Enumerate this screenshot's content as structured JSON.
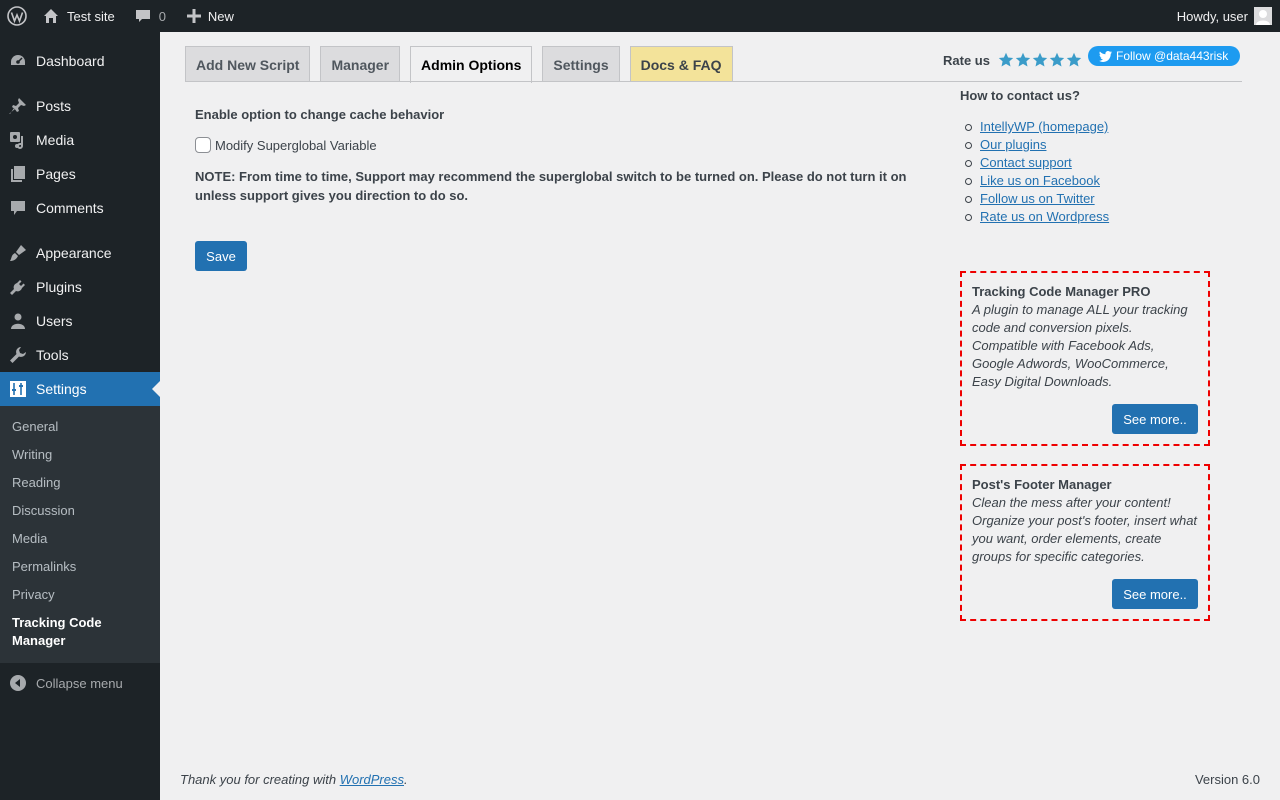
{
  "adminbar": {
    "site_name": "Test site",
    "comments_count": "0",
    "new_label": "New",
    "greeting": "Howdy, user"
  },
  "sidebar": {
    "items": [
      {
        "label": "Dashboard",
        "icon": "dashboard-icon"
      },
      {
        "label": "Posts",
        "icon": "pin-icon"
      },
      {
        "label": "Media",
        "icon": "media-icon"
      },
      {
        "label": "Pages",
        "icon": "pages-icon"
      },
      {
        "label": "Comments",
        "icon": "comment-icon"
      },
      {
        "label": "Appearance",
        "icon": "brush-icon"
      },
      {
        "label": "Plugins",
        "icon": "plug-icon"
      },
      {
        "label": "Users",
        "icon": "user-icon"
      },
      {
        "label": "Tools",
        "icon": "wrench-icon"
      },
      {
        "label": "Settings",
        "icon": "settings-icon"
      }
    ],
    "submenu": [
      "General",
      "Writing",
      "Reading",
      "Discussion",
      "Media",
      "Permalinks",
      "Privacy",
      "Tracking Code Manager"
    ],
    "collapse_label": "Collapse menu"
  },
  "tabs": [
    "Add New Script",
    "Manager",
    "Admin Options",
    "Settings",
    "Docs & FAQ"
  ],
  "rate": {
    "label": "Rate us",
    "stars": 5
  },
  "follow_label": "Follow @data443risk",
  "main": {
    "heading": "Enable option to change cache behavior",
    "checkbox_label": "Modify Superglobal Variable",
    "note": "NOTE: From time to time, Support may recommend the superglobal switch to be turned on. Please do not turn it on unless support gives you direction to do so.",
    "save_label": "Save"
  },
  "side": {
    "contact_title": "How to contact us?",
    "links": [
      "IntellyWP (homepage)",
      "Our plugins",
      "Contact support",
      "Like us on Facebook",
      "Follow us on Twitter",
      "Rate us on Wordpress"
    ],
    "promos": [
      {
        "title": "Tracking Code Manager PRO",
        "desc": "A plugin to manage ALL your tracking code and conversion pixels. Compatible with Facebook Ads, Google Adwords, WooCommerce, Easy Digital Downloads.",
        "button": "See more.."
      },
      {
        "title": "Post's Footer Manager",
        "desc": "Clean the mess after your content! Organize your post's footer, insert what you want, order elements, create groups for specific categories.",
        "button": "See more.."
      }
    ]
  },
  "footer": {
    "thanks_prefix": "Thank you for creating with ",
    "thanks_link": "WordPress",
    "thanks_suffix": ".",
    "version": "Version 6.0"
  },
  "colors": {
    "accent": "#2271b1",
    "sidebar": "#1d2327",
    "twitter": "#1d9bf0",
    "docs_tab": "#f3e39a",
    "promo_border": "#e00000"
  }
}
